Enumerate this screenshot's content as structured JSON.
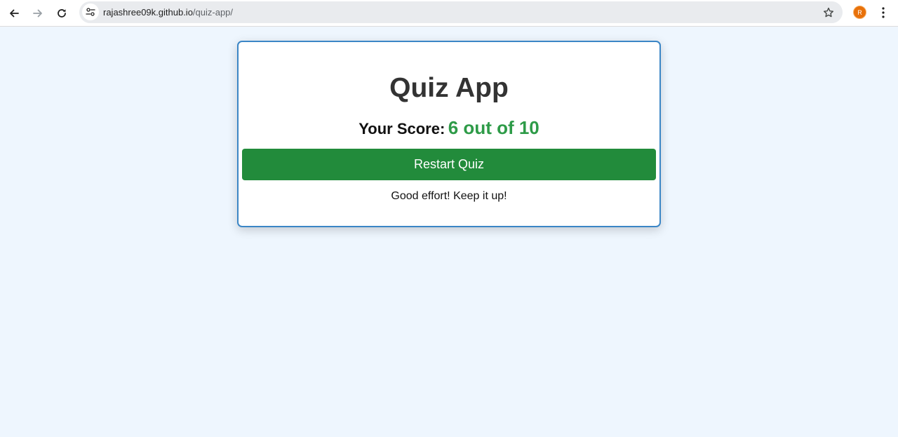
{
  "browser": {
    "url_host": "rajashree09k.github.io",
    "url_path": "/quiz-app/",
    "profile_initial": "R",
    "icons": [
      "back-arrow-icon",
      "forward-arrow-icon",
      "reload-icon",
      "site-info-icon",
      "bookmark-star-icon",
      "kebab-menu-icon"
    ]
  },
  "quiz": {
    "title": "Quiz App",
    "score_label": "Your Score:",
    "score_value": "6 out of 10",
    "restart_label": "Restart Quiz",
    "feedback": "Good effort! Keep it up!"
  },
  "colors": {
    "page_background": "#eef6fe",
    "card_border": "#3b86c6",
    "button_green": "#228b3b",
    "score_green": "#2e9b48",
    "avatar_orange": "#e8710a"
  }
}
